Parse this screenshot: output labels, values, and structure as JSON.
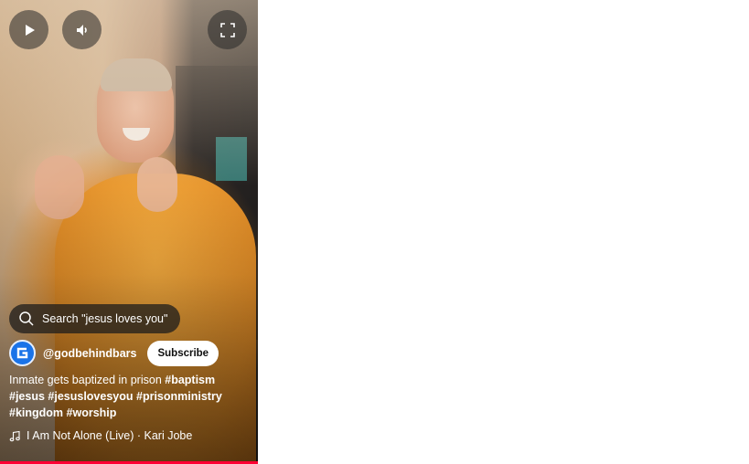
{
  "player": {
    "progress_fraction": 1.0,
    "controls": {
      "play_icon": "play-icon",
      "volume_icon": "volume-icon",
      "fullscreen_icon": "fullscreen-icon"
    }
  },
  "search": {
    "label": "Search \"jesus loves you\""
  },
  "channel": {
    "handle": "@godbehindbars",
    "subscribe_label": "Subscribe",
    "avatar_color": "#1a73e8"
  },
  "caption": {
    "text": "Inmate gets baptized in prison ",
    "hashtags": [
      "#baptism",
      "#jesus",
      "#jesuslovesyou",
      "#prisonministry",
      "#kingdom",
      "#worship"
    ]
  },
  "music": {
    "label": "I Am Not Alone (Live) · Kari Jobe"
  },
  "colors": {
    "progress": "#ff0033",
    "overlay": "#1c1c1c"
  }
}
